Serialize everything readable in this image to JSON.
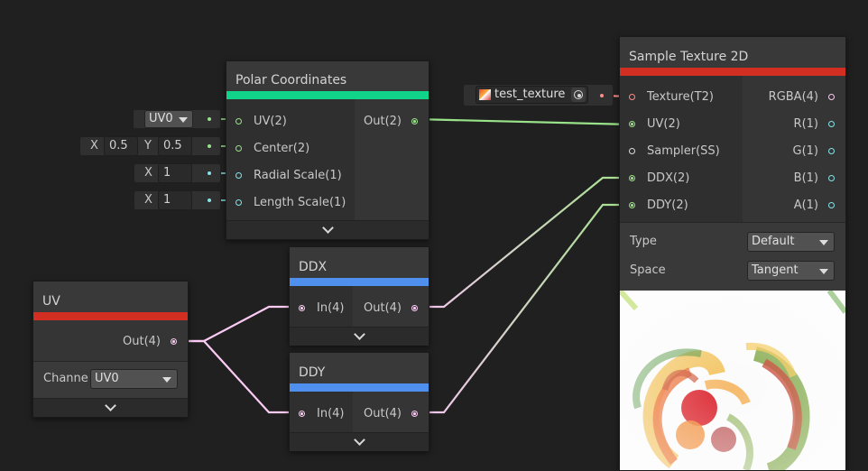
{
  "colors": {
    "background": "#202020",
    "polar_bar": "#0fd48a",
    "ddx_bar": "#4f90ee",
    "ddy_bar": "#4f90ee",
    "uv_bar": "#d22f22",
    "sample_bar": "#d22f22",
    "port_vec2": "#99e289",
    "port_float": "#84e4e7",
    "port_vec4": "#fbcbf4",
    "port_texture": "#ff8b8b"
  },
  "polar": {
    "title": "Polar Coordinates",
    "inputs": [
      "UV(2)",
      "Center(2)",
      "Radial Scale(1)",
      "Length Scale(1)"
    ],
    "output": "Out(2)",
    "uv_default": "UV0",
    "center": {
      "x_label": "X",
      "x": "0.5",
      "y_label": "Y",
      "y": "0.5"
    },
    "radial": {
      "x_label": "X",
      "x": "1"
    },
    "length": {
      "x_label": "X",
      "x": "1"
    }
  },
  "ddx": {
    "title": "DDX",
    "input": "In(4)",
    "output": "Out(4)"
  },
  "ddy": {
    "title": "DDY",
    "input": "In(4)",
    "output": "Out(4)"
  },
  "uv": {
    "title": "UV",
    "output": "Out(4)",
    "channel_label": "Channe",
    "channel_value": "UV0"
  },
  "sample": {
    "title": "Sample Texture 2D",
    "texture_name": "test_texture",
    "inputs": [
      "Texture(T2)",
      "UV(2)",
      "Sampler(SS)",
      "DDX(2)",
      "DDY(2)"
    ],
    "outputs": [
      "RGBA(4)",
      "R(1)",
      "G(1)",
      "B(1)",
      "A(1)"
    ],
    "type_label": "Type",
    "type_value": "Default",
    "space_label": "Space",
    "space_value": "Tangent"
  },
  "icons": {
    "expand": "chevron-down-icon",
    "dropdown": "dropdown-arrow-icon",
    "texture": "texture-thumbnail-icon",
    "object_picker": "object-picker-icon"
  }
}
